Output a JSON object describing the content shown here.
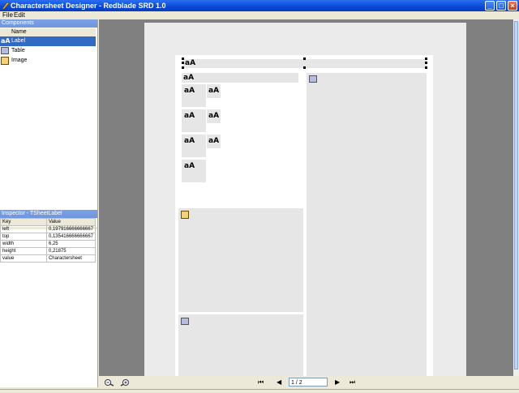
{
  "window": {
    "title": "Charactersheet Designer - Redblade SRD 1.0"
  },
  "menu": [
    "File",
    "Edit"
  ],
  "components": {
    "header": "Components",
    "column": "Name",
    "items": [
      {
        "label": "Label",
        "icon": "label-icon",
        "selected": true
      },
      {
        "label": "Table",
        "icon": "table-icon",
        "selected": false
      },
      {
        "label": "Image",
        "icon": "image-icon",
        "selected": false
      }
    ]
  },
  "inspector": {
    "header": "Inspector - TSheetLabel",
    "columns": [
      "Key",
      "Value"
    ],
    "rows": [
      [
        "left",
        "0,197916666666667"
      ],
      [
        "top",
        "0,135416666666667"
      ],
      [
        "width",
        "6,25"
      ],
      [
        "height",
        "0,21875"
      ],
      [
        "value",
        "Charactersheet"
      ]
    ]
  },
  "canvas": {
    "label_glyph": "aA"
  },
  "navigator": {
    "page": "1 / 2",
    "first": "⏮",
    "prev": "◀",
    "next": "▶",
    "last": "⏭"
  }
}
